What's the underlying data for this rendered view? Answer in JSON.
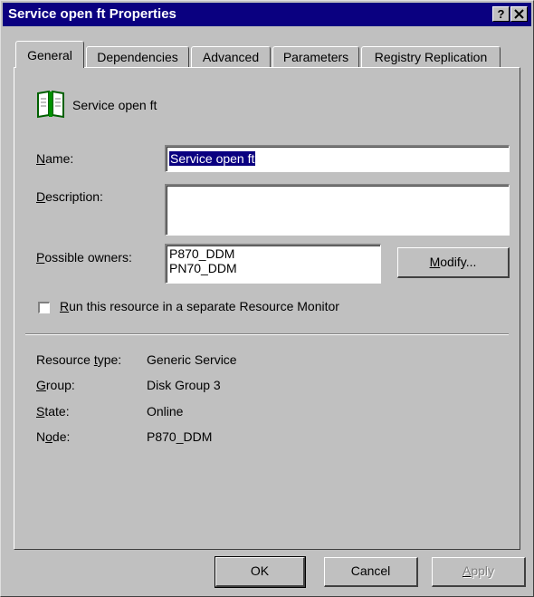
{
  "window": {
    "title": "Service open ft Properties",
    "help_label": "?",
    "close_label": "✕"
  },
  "tabs": [
    {
      "label": "General",
      "active": true
    },
    {
      "label": "Dependencies",
      "active": false
    },
    {
      "label": "Advanced",
      "active": false
    },
    {
      "label": "Parameters",
      "active": false
    },
    {
      "label": "Registry Replication",
      "active": false
    }
  ],
  "header": {
    "icon": "book-icon",
    "resource_name": "Service open ft"
  },
  "form": {
    "name": {
      "label_pre": "",
      "label_accel": "N",
      "label_post": "ame:",
      "value": "Service open ft"
    },
    "description": {
      "label_pre": "",
      "label_accel": "D",
      "label_post": "escription:",
      "value": ""
    },
    "possible_owners": {
      "label_pre": "",
      "label_accel": "P",
      "label_post": "ossible owners:",
      "items": [
        "P870_DDM",
        "PN70_DDM"
      ]
    },
    "modify_button": {
      "pre": "",
      "accel": "M",
      "post": "odify..."
    },
    "separate_monitor": {
      "pre": "",
      "accel": "R",
      "post": "un this resource in a separate Resource Monitor",
      "checked": false
    }
  },
  "info": [
    {
      "label_pre": "Resource ",
      "label_accel": "t",
      "label_post": "ype:",
      "value": "Generic Service"
    },
    {
      "label_pre": "",
      "label_accel": "G",
      "label_post": "roup:",
      "value": "Disk Group 3"
    },
    {
      "label_pre": "",
      "label_accel": "S",
      "label_post": "tate:",
      "value": "Online"
    },
    {
      "label_pre": "N",
      "label_accel": "o",
      "label_post": "de:",
      "value": "P870_DDM"
    }
  ],
  "footer": {
    "ok": "OK",
    "cancel": "Cancel",
    "apply": {
      "pre": "",
      "accel": "A",
      "post": "pply",
      "disabled": true
    }
  },
  "colors": {
    "titlebar": "#0a0080",
    "face": "#c0c0c0",
    "selection": "#0a0080"
  }
}
